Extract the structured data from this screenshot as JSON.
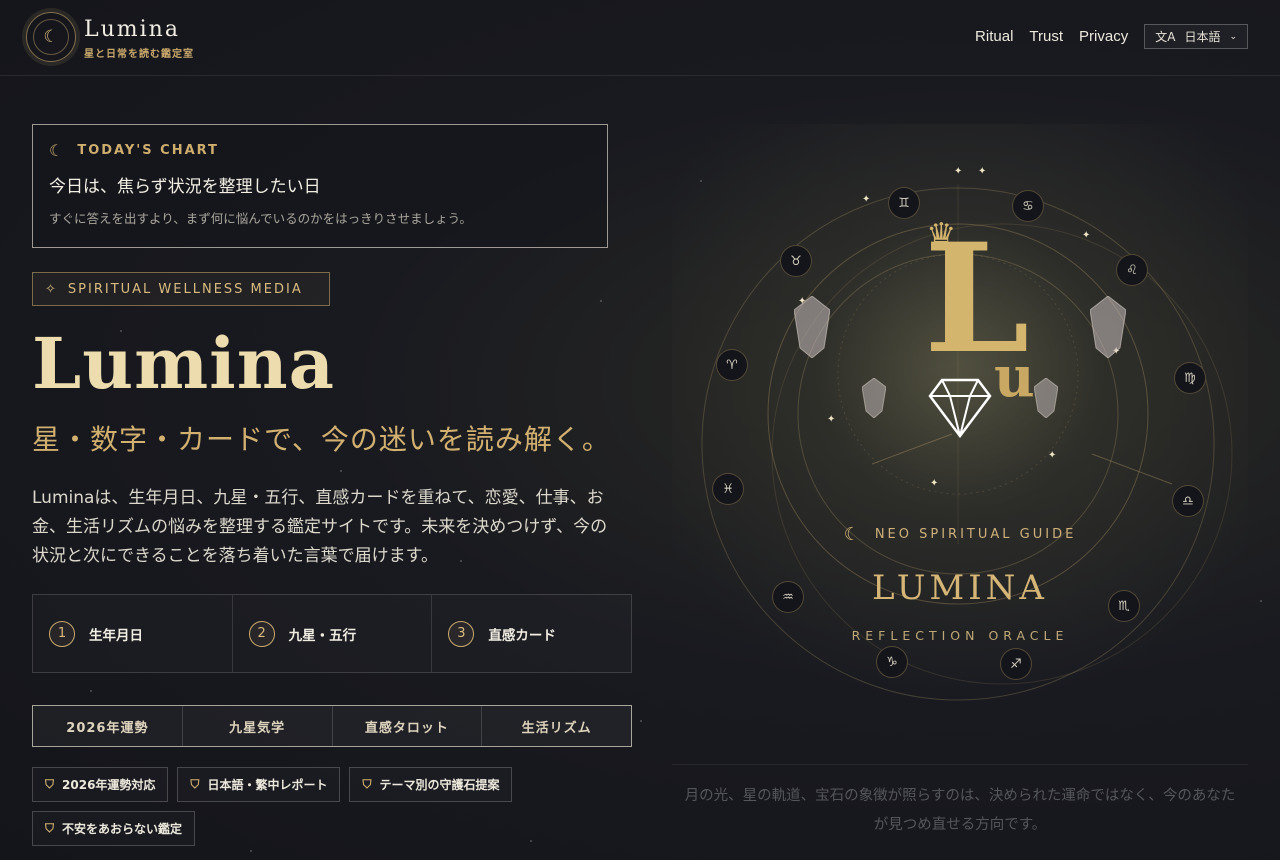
{
  "header": {
    "logo_icon": "moon-icon",
    "brand_name": "Lumina",
    "brand_tagline": "星と日常を読む鑑定室",
    "nav": [
      {
        "label": "Ritual"
      },
      {
        "label": "Trust"
      },
      {
        "label": "Privacy"
      }
    ],
    "language": {
      "icon": "translate-icon",
      "label": "日本語"
    }
  },
  "today": {
    "heading": "TODAY'S CHART",
    "title": "今日は、焦らず状況を整理したい日",
    "description": "すぐに答えを出すより、まず何に悩んでいるのかをはっきりさせましょう。"
  },
  "hero": {
    "tag": "SPIRITUAL WELLNESS MEDIA",
    "title": "Lumina",
    "subtitle": "星・数字・カードで、今の迷いを読み解く。",
    "body": "Luminaは、生年月日、九星・五行、直感カードを重ねて、恋愛、仕事、お金、生活リズムの悩みを整理する鑑定サイトです。未来を決めつけず、今の状況と次にできることを落ち着いた言葉で届けます。"
  },
  "steps": [
    {
      "num": "1",
      "label": "生年月日"
    },
    {
      "num": "2",
      "label": "九星・五行"
    },
    {
      "num": "3",
      "label": "直感カード"
    }
  ],
  "tabs": [
    {
      "label": "2026年運勢"
    },
    {
      "label": "九星気学"
    },
    {
      "label": "直感タロット"
    },
    {
      "label": "生活リズム"
    }
  ],
  "badges": [
    {
      "label": "2026年運勢対応"
    },
    {
      "label": "日本語・繁中レポート"
    },
    {
      "label": "テーマ別の守護石提案"
    },
    {
      "label": "不安をあおらない鑑定"
    }
  ],
  "artwork": {
    "monogram_big": "L",
    "monogram_small": "u",
    "guide_label": "NEO SPIRITUAL GUIDE",
    "name": "LUMINA",
    "subtitle": "REFLECTION ORACLE",
    "zodiac": [
      "♊",
      "♋",
      "♌",
      "♍",
      "♎",
      "♏",
      "♐",
      "♑",
      "♒",
      "♓",
      "♈",
      "♉"
    ],
    "caption": "月の光、星の軌道、宝石の象徴が照らすのは、決められた運命ではなく、今のあなたが見つめ直せる方向です。"
  },
  "colors": {
    "background": "#191a20",
    "gold": "#d2b06f",
    "text": "#e9e4d6"
  }
}
